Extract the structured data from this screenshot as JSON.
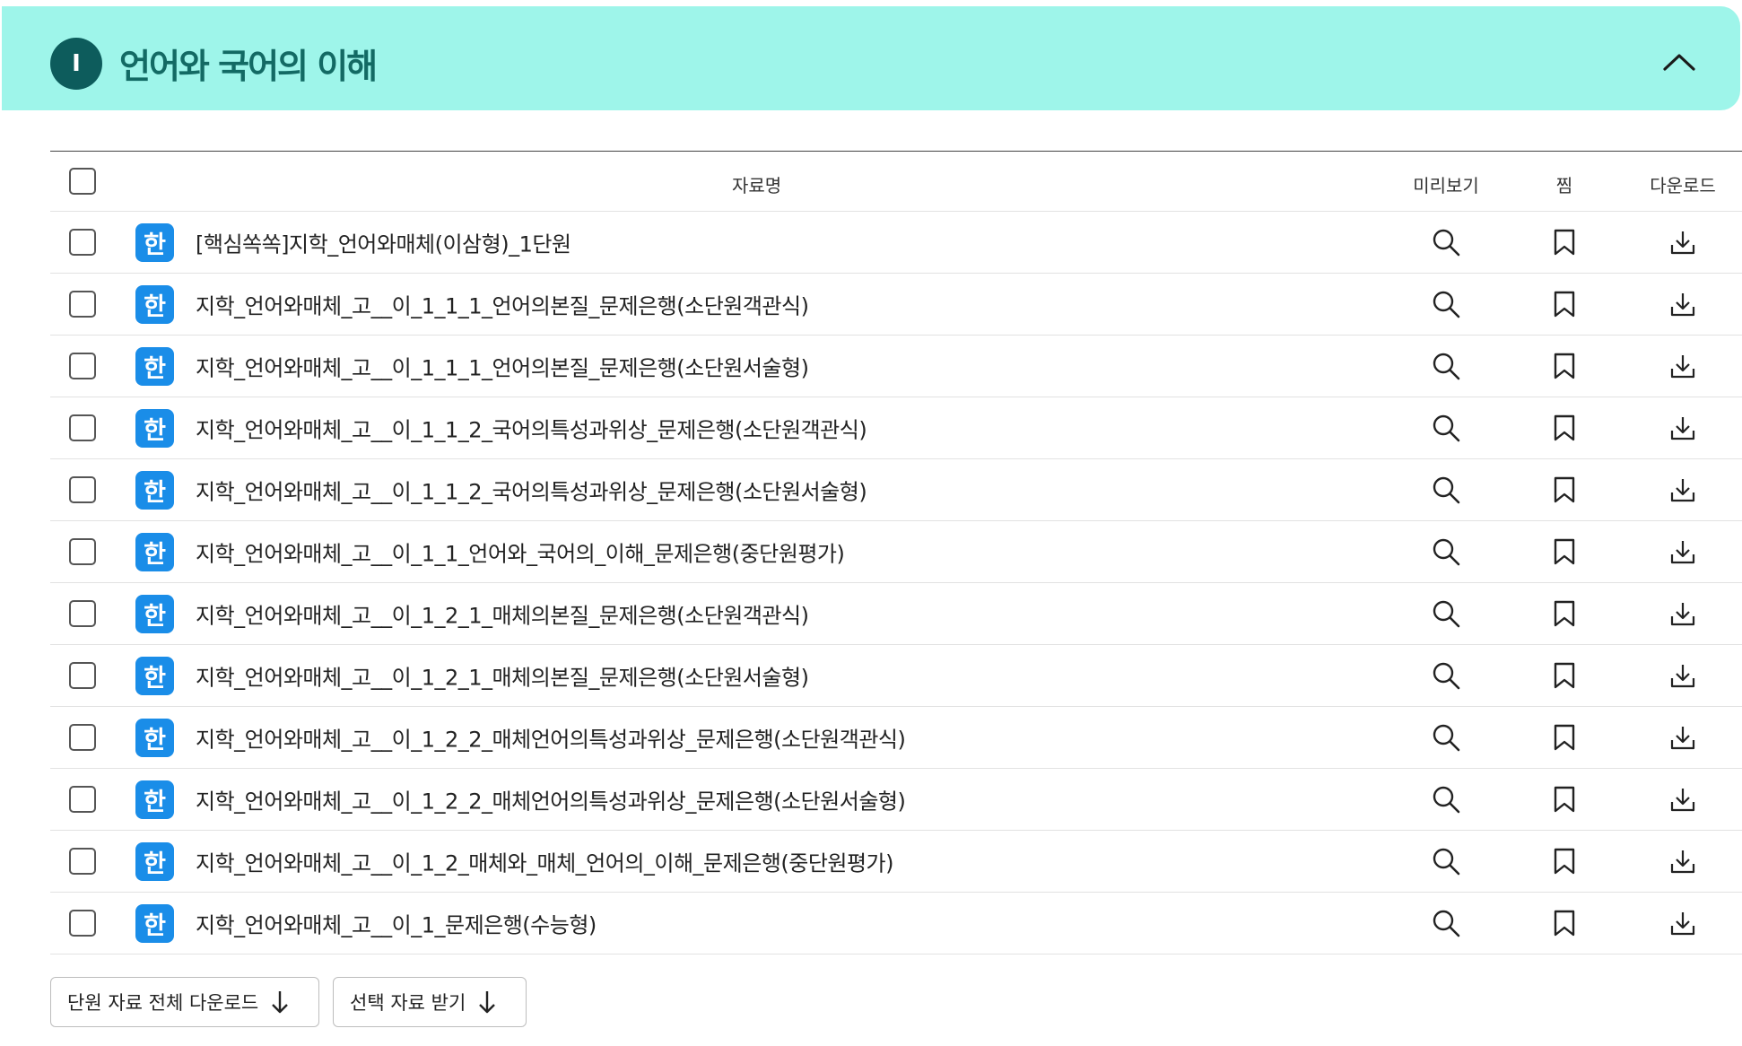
{
  "section": {
    "badge": "I",
    "title": "언어와 국어의 이해"
  },
  "table": {
    "columns": {
      "name": "자료명",
      "preview": "미리보기",
      "bookmark": "찜",
      "download": "다운로드"
    },
    "file_icon_glyph": "한",
    "rows": [
      {
        "name": "[핵심쏙쏙]지학_언어와매체(이삼형)_1단원"
      },
      {
        "name": "지학_언어와매체_고__이_1_1_1_언어의본질_문제은행(소단원객관식)"
      },
      {
        "name": "지학_언어와매체_고__이_1_1_1_언어의본질_문제은행(소단원서술형)"
      },
      {
        "name": "지학_언어와매체_고__이_1_1_2_국어의특성과위상_문제은행(소단원객관식)"
      },
      {
        "name": "지학_언어와매체_고__이_1_1_2_국어의특성과위상_문제은행(소단원서술형)"
      },
      {
        "name": "지학_언어와매체_고__이_1_1_언어와_국어의_이해_문제은행(중단원평가)"
      },
      {
        "name": "지학_언어와매체_고__이_1_2_1_매체의본질_문제은행(소단원객관식)"
      },
      {
        "name": "지학_언어와매체_고__이_1_2_1_매체의본질_문제은행(소단원서술형)"
      },
      {
        "name": "지학_언어와매체_고__이_1_2_2_매체언어의특성과위상_문제은행(소단원객관식)"
      },
      {
        "name": "지학_언어와매체_고__이_1_2_2_매체언어의특성과위상_문제은행(소단원서술형)"
      },
      {
        "name": "지학_언어와매체_고__이_1_2_매체와_매체_언어의_이해_문제은행(중단원평가)"
      },
      {
        "name": "지학_언어와매체_고__이_1_문제은행(수능형)"
      }
    ]
  },
  "actions": {
    "download_all_label": "단원 자료 전체 다운로드",
    "download_selected_label": "선택 자료 받기"
  },
  "colors": {
    "header_bg": "#9ef5ea",
    "badge_bg": "#0d5c5c",
    "title_color": "#136a64",
    "file_icon_bg": "#1a8de8"
  },
  "icons": [
    "chevron-up-icon",
    "hwp-file-icon",
    "search-icon",
    "bookmark-icon",
    "download-icon",
    "arrow-down-icon"
  ]
}
